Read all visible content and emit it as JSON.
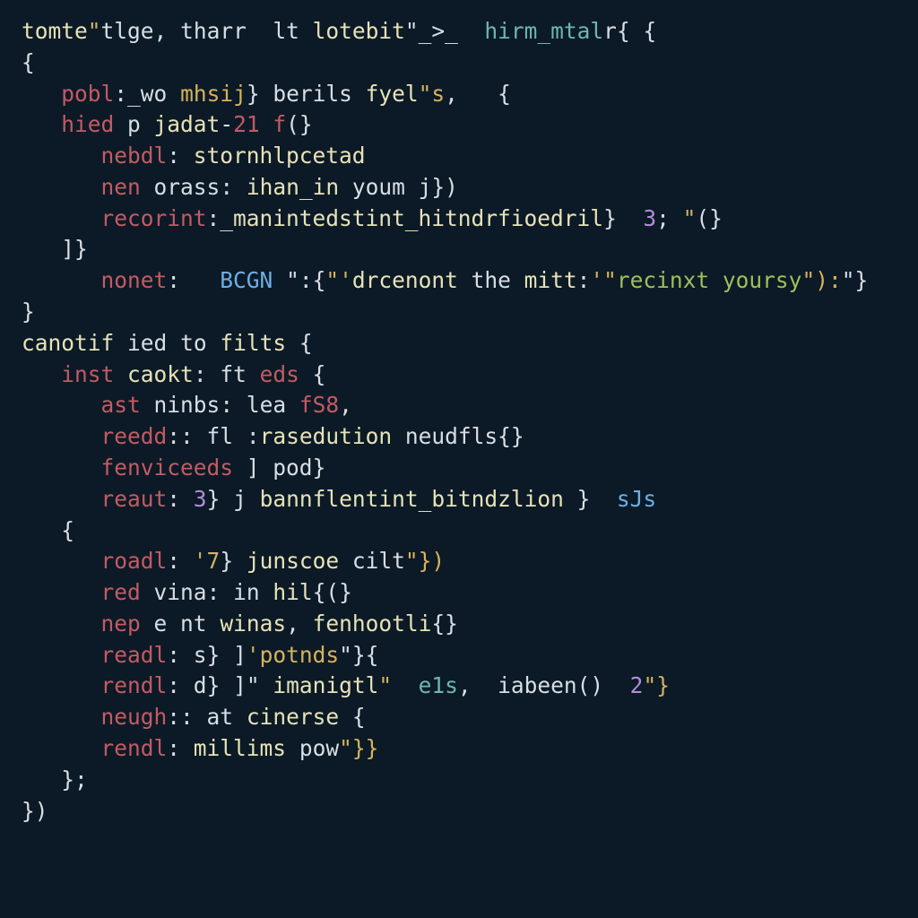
{
  "lines": [
    {
      "indent": 0,
      "tokens": [
        {
          "t": "tomte",
          "c": "c-def"
        },
        {
          "t": "\"",
          "c": "c-str"
        },
        {
          "t": "tlge",
          "c": "c-plain"
        },
        {
          "t": ", ",
          "c": "c-punc"
        },
        {
          "t": "tharr",
          "c": "c-plain"
        },
        {
          "t": "  ",
          "c": "c-punc"
        },
        {
          "t": "lt",
          "c": "c-plain"
        },
        {
          "t": " ",
          "c": "c-punc"
        },
        {
          "t": "lotebit",
          "c": "c-def"
        },
        {
          "t": "\"_>_  ",
          "c": "c-punc"
        },
        {
          "t": "hirm_mtal",
          "c": "c-cyan"
        },
        {
          "t": "r",
          "c": "c-plain"
        },
        {
          "t": "{ {",
          "c": "c-punc"
        }
      ]
    },
    {
      "indent": 0,
      "tokens": [
        {
          "t": "{",
          "c": "c-punc"
        }
      ]
    },
    {
      "indent": 1,
      "tokens": [
        {
          "t": "pobl",
          "c": "c-key"
        },
        {
          "t": ":_",
          "c": "c-punc"
        },
        {
          "t": "wo",
          "c": "c-plain"
        },
        {
          "t": " ",
          "c": "c-punc"
        },
        {
          "t": "mhsij",
          "c": "c-func"
        },
        {
          "t": "} ",
          "c": "c-punc"
        },
        {
          "t": "berils",
          "c": "c-plain"
        },
        {
          "t": " ",
          "c": "c-punc"
        },
        {
          "t": "fyel",
          "c": "c-def"
        },
        {
          "t": "\"s",
          "c": "c-str"
        },
        {
          "t": ",   {",
          "c": "c-punc"
        }
      ]
    },
    {
      "indent": 1,
      "tokens": [
        {
          "t": "hied",
          "c": "c-key"
        },
        {
          "t": " p ",
          "c": "c-plain"
        },
        {
          "t": "jadat",
          "c": "c-def"
        },
        {
          "t": "-",
          "c": "c-punc"
        },
        {
          "t": "21",
          "c": "c-key"
        },
        {
          "t": " f",
          "c": "c-key"
        },
        {
          "t": "(}",
          "c": "c-punc"
        }
      ]
    },
    {
      "indent": 2,
      "tokens": [
        {
          "t": "nebdl",
          "c": "c-key"
        },
        {
          "t": ": ",
          "c": "c-punc"
        },
        {
          "t": "stornhlpcetad",
          "c": "c-def"
        }
      ]
    },
    {
      "indent": 2,
      "tokens": [
        {
          "t": "nen",
          "c": "c-key"
        },
        {
          "t": " ",
          "c": "c-punc"
        },
        {
          "t": "orass",
          "c": "c-plain"
        },
        {
          "t": ": ",
          "c": "c-punc"
        },
        {
          "t": "ihan_in",
          "c": "c-def"
        },
        {
          "t": " ",
          "c": "c-punc"
        },
        {
          "t": "youm",
          "c": "c-plain"
        },
        {
          "t": " j})",
          "c": "c-punc"
        }
      ]
    },
    {
      "indent": 2,
      "tokens": [
        {
          "t": "recorint",
          "c": "c-key"
        },
        {
          "t": ":_",
          "c": "c-punc"
        },
        {
          "t": "manintedstint_hitndrfioedril",
          "c": "c-def"
        },
        {
          "t": "}  ",
          "c": "c-punc"
        },
        {
          "t": "3",
          "c": "c-num"
        },
        {
          "t": ";",
          "c": "c-punc"
        },
        {
          "t": " \"",
          "c": "c-str"
        },
        {
          "t": "(}",
          "c": "c-punc"
        }
      ]
    },
    {
      "indent": 1,
      "tokens": [
        {
          "t": "]}",
          "c": "c-punc"
        }
      ]
    },
    {
      "indent": 2,
      "tokens": [
        {
          "t": "nonet",
          "c": "c-key"
        },
        {
          "t": ":   ",
          "c": "c-punc"
        },
        {
          "t": "BCGN",
          "c": "c-const"
        },
        {
          "t": " \":{",
          "c": "c-punc"
        },
        {
          "t": "\"'",
          "c": "c-str"
        },
        {
          "t": "drcenont",
          "c": "c-def"
        },
        {
          "t": " the ",
          "c": "c-plain"
        },
        {
          "t": "mitt",
          "c": "c-def"
        },
        {
          "t": ":",
          "c": "c-punc"
        },
        {
          "t": "'\"",
          "c": "c-str"
        },
        {
          "t": "recinxt yoursy",
          "c": "c-lime"
        },
        {
          "t": "\"):",
          "c": "c-str"
        },
        {
          "t": "\"}",
          "c": "c-punc"
        }
      ]
    },
    {
      "indent": 0,
      "tokens": [
        {
          "t": "}",
          "c": "c-punc"
        }
      ]
    },
    {
      "indent": 0,
      "tokens": [
        {
          "t": "",
          "c": "c-punc"
        }
      ]
    },
    {
      "indent": 0,
      "tokens": [
        {
          "t": "",
          "c": "c-punc"
        }
      ]
    },
    {
      "indent": 0,
      "tokens": [
        {
          "t": "canotif",
          "c": "c-def"
        },
        {
          "t": " ",
          "c": "c-punc"
        },
        {
          "t": "ied",
          "c": "c-plain"
        },
        {
          "t": " ",
          "c": "c-punc"
        },
        {
          "t": "to",
          "c": "c-plain"
        },
        {
          "t": " ",
          "c": "c-punc"
        },
        {
          "t": "filts",
          "c": "c-def"
        },
        {
          "t": " {",
          "c": "c-punc"
        }
      ]
    },
    {
      "indent": 1,
      "tokens": [
        {
          "t": "inst",
          "c": "c-key"
        },
        {
          "t": " ",
          "c": "c-punc"
        },
        {
          "t": "caokt",
          "c": "c-def"
        },
        {
          "t": ": ",
          "c": "c-punc"
        },
        {
          "t": "ft",
          "c": "c-plain"
        },
        {
          "t": " ",
          "c": "c-punc"
        },
        {
          "t": "eds",
          "c": "c-key"
        },
        {
          "t": " {",
          "c": "c-punc"
        }
      ]
    },
    {
      "indent": 2,
      "tokens": [
        {
          "t": "ast",
          "c": "c-key"
        },
        {
          "t": " ",
          "c": "c-punc"
        },
        {
          "t": "ninbs",
          "c": "c-plain"
        },
        {
          "t": ": ",
          "c": "c-punc"
        },
        {
          "t": "lea",
          "c": "c-plain"
        },
        {
          "t": " ",
          "c": "c-punc"
        },
        {
          "t": "fS8",
          "c": "c-key"
        },
        {
          "t": ",",
          "c": "c-punc"
        }
      ]
    },
    {
      "indent": 2,
      "tokens": [
        {
          "t": "reedd",
          "c": "c-key"
        },
        {
          "t": ":: ",
          "c": "c-punc"
        },
        {
          "t": "fl",
          "c": "c-plain"
        },
        {
          "t": " :",
          "c": "c-punc"
        },
        {
          "t": "rasedution",
          "c": "c-def"
        },
        {
          "t": " ",
          "c": "c-punc"
        },
        {
          "t": "neudfls",
          "c": "c-plain"
        },
        {
          "t": "{}",
          "c": "c-punc"
        }
      ]
    },
    {
      "indent": 2,
      "tokens": [
        {
          "t": "fenviceeds",
          "c": "c-key"
        },
        {
          "t": " ] ",
          "c": "c-punc"
        },
        {
          "t": "pod",
          "c": "c-plain"
        },
        {
          "t": "}",
          "c": "c-punc"
        }
      ]
    },
    {
      "indent": 2,
      "tokens": [
        {
          "t": "reaut",
          "c": "c-key"
        },
        {
          "t": ": ",
          "c": "c-punc"
        },
        {
          "t": "3",
          "c": "c-num"
        },
        {
          "t": "} j ",
          "c": "c-punc"
        },
        {
          "t": "bannflentint_bitndzlion",
          "c": "c-def"
        },
        {
          "t": " }  ",
          "c": "c-punc"
        },
        {
          "t": "sJs",
          "c": "c-type"
        }
      ]
    },
    {
      "indent": 1,
      "tokens": [
        {
          "t": "{",
          "c": "c-punc"
        }
      ]
    },
    {
      "indent": 2,
      "tokens": [
        {
          "t": "roadl",
          "c": "c-key"
        },
        {
          "t": ": ",
          "c": "c-punc"
        },
        {
          "t": "'7",
          "c": "c-str"
        },
        {
          "t": "} ",
          "c": "c-punc"
        },
        {
          "t": "junscoe",
          "c": "c-def"
        },
        {
          "t": " ",
          "c": "c-punc"
        },
        {
          "t": "cilt",
          "c": "c-plain"
        },
        {
          "t": "\"})",
          "c": "c-str"
        }
      ]
    },
    {
      "indent": 2,
      "tokens": [
        {
          "t": "red",
          "c": "c-key"
        },
        {
          "t": " ",
          "c": "c-punc"
        },
        {
          "t": "vina",
          "c": "c-plain"
        },
        {
          "t": ": ",
          "c": "c-punc"
        },
        {
          "t": "in",
          "c": "c-plain"
        },
        {
          "t": " ",
          "c": "c-punc"
        },
        {
          "t": "hil",
          "c": "c-def"
        },
        {
          "t": "{(}",
          "c": "c-punc"
        }
      ]
    },
    {
      "indent": 2,
      "tokens": [
        {
          "t": "nep",
          "c": "c-key"
        },
        {
          "t": " e ",
          "c": "c-plain"
        },
        {
          "t": "nt",
          "c": "c-plain"
        },
        {
          "t": " ",
          "c": "c-punc"
        },
        {
          "t": "winas",
          "c": "c-def"
        },
        {
          "t": ", ",
          "c": "c-punc"
        },
        {
          "t": "fenhootli",
          "c": "c-def"
        },
        {
          "t": "{}",
          "c": "c-punc"
        }
      ]
    },
    {
      "indent": 2,
      "tokens": [
        {
          "t": "readl",
          "c": "c-key"
        },
        {
          "t": ": ",
          "c": "c-punc"
        },
        {
          "t": "s",
          "c": "c-plain"
        },
        {
          "t": "} ]",
          "c": "c-punc"
        },
        {
          "t": "'potnds",
          "c": "c-str"
        },
        {
          "t": "\"}{",
          "c": "c-punc"
        }
      ]
    },
    {
      "indent": 2,
      "tokens": [
        {
          "t": "rendl",
          "c": "c-key"
        },
        {
          "t": ": ",
          "c": "c-punc"
        },
        {
          "t": "d",
          "c": "c-plain"
        },
        {
          "t": "} ]\" ",
          "c": "c-punc"
        },
        {
          "t": "imanigtl",
          "c": "c-def"
        },
        {
          "t": "\"  ",
          "c": "c-str"
        },
        {
          "t": "e1s",
          "c": "c-cyan"
        },
        {
          "t": ",  ",
          "c": "c-punc"
        },
        {
          "t": "iabeen",
          "c": "c-plain"
        },
        {
          "t": "()  ",
          "c": "c-punc"
        },
        {
          "t": "2",
          "c": "c-num"
        },
        {
          "t": "\"}",
          "c": "c-str"
        }
      ]
    },
    {
      "indent": 2,
      "tokens": [
        {
          "t": "neugh",
          "c": "c-key"
        },
        {
          "t": ":: ",
          "c": "c-punc"
        },
        {
          "t": "at",
          "c": "c-plain"
        },
        {
          "t": " ",
          "c": "c-punc"
        },
        {
          "t": "cinerse",
          "c": "c-def"
        },
        {
          "t": " {",
          "c": "c-punc"
        }
      ]
    },
    {
      "indent": 2,
      "tokens": [
        {
          "t": "rendl",
          "c": "c-key"
        },
        {
          "t": ": ",
          "c": "c-punc"
        },
        {
          "t": "millims",
          "c": "c-def"
        },
        {
          "t": " ",
          "c": "c-punc"
        },
        {
          "t": "pow",
          "c": "c-plain"
        },
        {
          "t": "\"}}",
          "c": "c-str"
        }
      ]
    },
    {
      "indent": 1,
      "tokens": [
        {
          "t": "};",
          "c": "c-punc"
        }
      ]
    },
    {
      "indent": 0,
      "tokens": [
        {
          "t": "})",
          "c": "c-punc"
        }
      ]
    }
  ],
  "indent_unit": "   "
}
